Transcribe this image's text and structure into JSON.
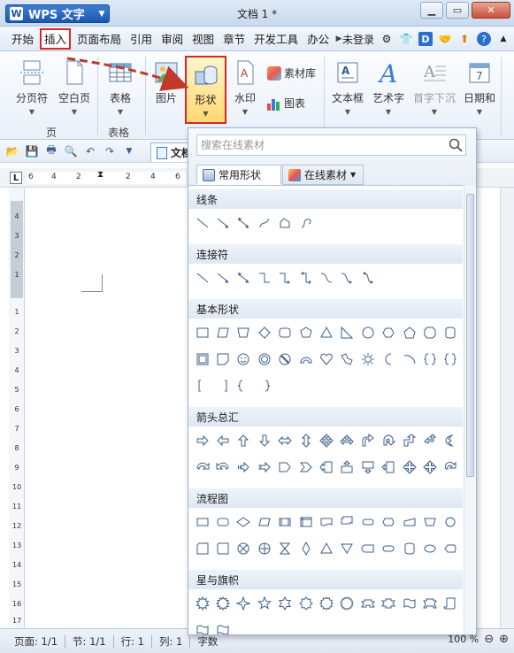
{
  "app": {
    "button_label": "WPS 文字",
    "logo_letter": "W",
    "doc_title": "文档 1 *"
  },
  "menu": {
    "items": [
      "开始",
      "插入",
      "页面布局",
      "引用",
      "审阅",
      "视图",
      "章节",
      "开发工具",
      "办公"
    ],
    "active": "插入",
    "login": "未登录"
  },
  "ribbon": {
    "page_break": "分页符",
    "blank_page": "空白页",
    "table": "表格",
    "picture": "图片",
    "shape": "形状",
    "watermark": "水印",
    "material_lib": "素材库",
    "chart": "图表",
    "textbox": "文本框",
    "wordart": "艺术字",
    "dropcap": "首字下沉",
    "datetime": "日期和",
    "group_page": "页",
    "group_table": "表格"
  },
  "qat": {
    "doc_tab": "文档 1"
  },
  "ruler": {
    "numbers": [
      "6",
      "4",
      "2",
      "2",
      "4",
      "6"
    ]
  },
  "vruler": {
    "numbers": [
      "4",
      "3",
      "2",
      "1",
      "1",
      "2",
      "3",
      "4",
      "5",
      "6",
      "7",
      "8",
      "9",
      "10",
      "11",
      "12",
      "13",
      "14",
      "15",
      "16",
      "17"
    ]
  },
  "status": {
    "page": "页面: 1/1",
    "section": "节: 1/1",
    "row": "行: 1",
    "col": "列: 1",
    "words": "字数",
    "zoom": "100 %"
  },
  "popup": {
    "search_placeholder": "搜索在线素材",
    "tab_common": "常用形状",
    "tab_online": "在线素材",
    "categories": [
      "线条",
      "连接符",
      "基本形状",
      "箭头总汇",
      "流程图",
      "星与旗帜"
    ]
  },
  "colors": {
    "accent_red": "#d62828",
    "highlight": "#ffd873",
    "brand_blue": "#1c58ad",
    "annotation_arrow": "#c0392b"
  }
}
